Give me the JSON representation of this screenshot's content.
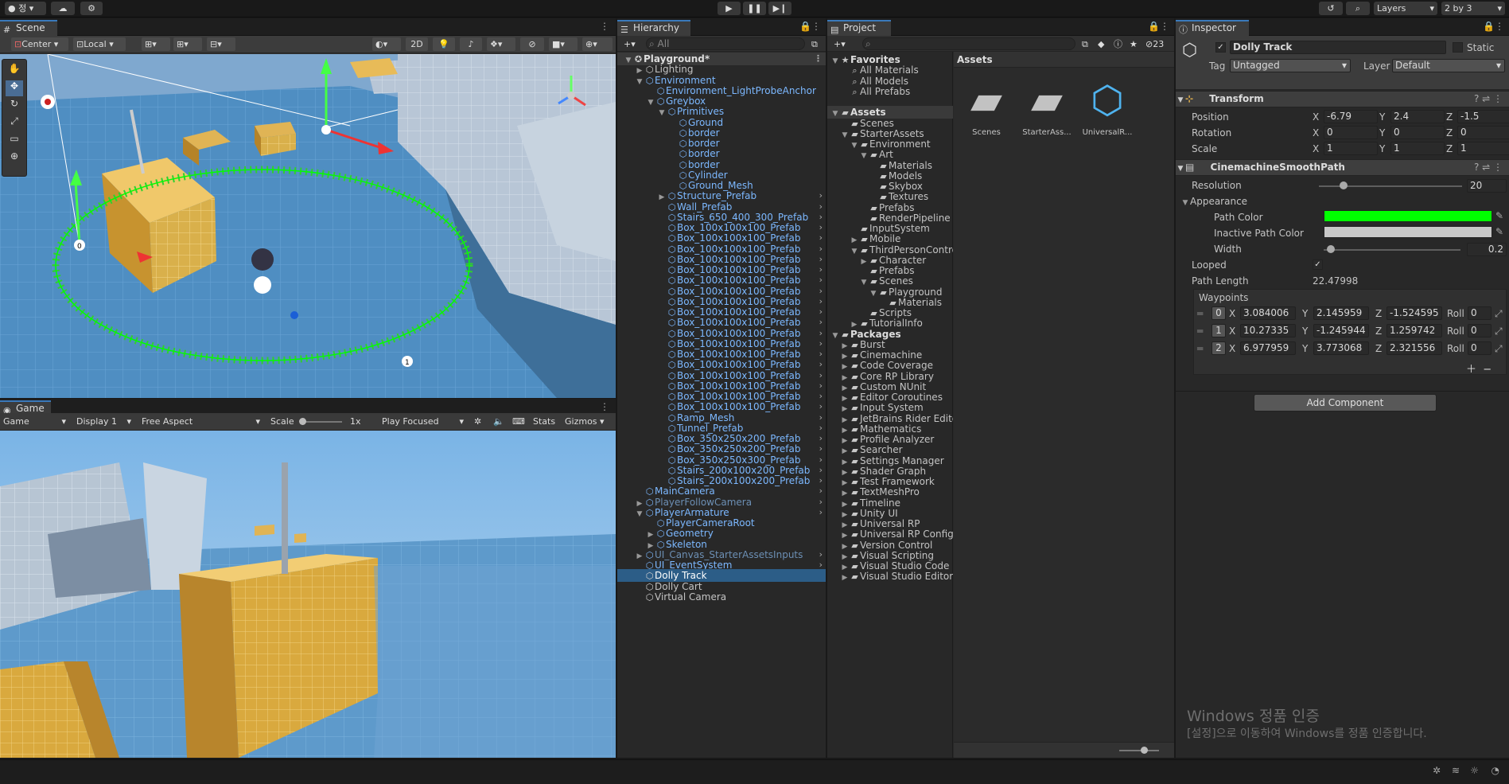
{
  "topbar": {
    "account": "정",
    "play": "▶",
    "pause": "❚❚",
    "step": "▶❙",
    "layers": "Layers",
    "layout": "2 by 3"
  },
  "scene": {
    "tab": "Scene",
    "pivot": "Center",
    "space": "Local",
    "mode2d": "2D",
    "waypoint0": "0",
    "waypoint1": "1"
  },
  "game": {
    "tab": "Game",
    "display_type": "Game",
    "display": "Display 1",
    "aspect": "Free Aspect",
    "scale_label": "Scale",
    "scale_value": "1x",
    "play_mode": "Play Focused",
    "stats": "Stats",
    "gizmos": "Gizmos"
  },
  "hierarchy": {
    "tab": "Hierarchy",
    "search_placeholder": "All",
    "items": [
      {
        "depth": 0,
        "label": "Playground*",
        "style": "root",
        "exp": "open"
      },
      {
        "depth": 1,
        "label": "Lighting",
        "style": "white",
        "exp": "closed"
      },
      {
        "depth": 1,
        "label": "Environment",
        "style": "blue",
        "exp": "open"
      },
      {
        "depth": 2,
        "label": "Environment_LightProbeAnchor",
        "style": "blue",
        "exp": "none"
      },
      {
        "depth": 2,
        "label": "Greybox",
        "style": "blue",
        "exp": "open"
      },
      {
        "depth": 3,
        "label": "Primitives",
        "style": "blue",
        "exp": "open"
      },
      {
        "depth": 4,
        "label": "Ground",
        "style": "blue",
        "exp": "none"
      },
      {
        "depth": 4,
        "label": "border",
        "style": "blue",
        "exp": "none"
      },
      {
        "depth": 4,
        "label": "border",
        "style": "blue",
        "exp": "none"
      },
      {
        "depth": 4,
        "label": "border",
        "style": "blue",
        "exp": "none"
      },
      {
        "depth": 4,
        "label": "border",
        "style": "blue",
        "exp": "none"
      },
      {
        "depth": 4,
        "label": "Cylinder",
        "style": "blue",
        "exp": "none"
      },
      {
        "depth": 4,
        "label": "Ground_Mesh",
        "style": "blue",
        "exp": "none"
      },
      {
        "depth": 3,
        "label": "Structure_Prefab",
        "style": "blue",
        "exp": "closed",
        "more": true
      },
      {
        "depth": 3,
        "label": "Wall_Prefab",
        "style": "blue",
        "exp": "none",
        "more": true
      },
      {
        "depth": 3,
        "label": "Stairs_650_400_300_Prefab",
        "style": "blue",
        "exp": "none",
        "more": true
      },
      {
        "depth": 3,
        "label": "Box_100x100x100_Prefab",
        "style": "blue",
        "exp": "none",
        "more": true
      },
      {
        "depth": 3,
        "label": "Box_100x100x100_Prefab",
        "style": "blue",
        "exp": "none",
        "more": true
      },
      {
        "depth": 3,
        "label": "Box_100x100x100_Prefab",
        "style": "blue",
        "exp": "none",
        "more": true
      },
      {
        "depth": 3,
        "label": "Box_100x100x100_Prefab",
        "style": "blue",
        "exp": "none",
        "more": true
      },
      {
        "depth": 3,
        "label": "Box_100x100x100_Prefab",
        "style": "blue",
        "exp": "none",
        "more": true
      },
      {
        "depth": 3,
        "label": "Box_100x100x100_Prefab",
        "style": "blue",
        "exp": "none",
        "more": true
      },
      {
        "depth": 3,
        "label": "Box_100x100x100_Prefab",
        "style": "blue",
        "exp": "none",
        "more": true
      },
      {
        "depth": 3,
        "label": "Box_100x100x100_Prefab",
        "style": "blue",
        "exp": "none",
        "more": true
      },
      {
        "depth": 3,
        "label": "Box_100x100x100_Prefab",
        "style": "blue",
        "exp": "none",
        "more": true
      },
      {
        "depth": 3,
        "label": "Box_100x100x100_Prefab",
        "style": "blue",
        "exp": "none",
        "more": true
      },
      {
        "depth": 3,
        "label": "Box_100x100x100_Prefab",
        "style": "blue",
        "exp": "none",
        "more": true
      },
      {
        "depth": 3,
        "label": "Box_100x100x100_Prefab",
        "style": "blue",
        "exp": "none",
        "more": true
      },
      {
        "depth": 3,
        "label": "Box_100x100x100_Prefab",
        "style": "blue",
        "exp": "none",
        "more": true
      },
      {
        "depth": 3,
        "label": "Box_100x100x100_Prefab",
        "style": "blue",
        "exp": "none",
        "more": true
      },
      {
        "depth": 3,
        "label": "Box_100x100x100_Prefab",
        "style": "blue",
        "exp": "none",
        "more": true
      },
      {
        "depth": 3,
        "label": "Box_100x100x100_Prefab",
        "style": "blue",
        "exp": "none",
        "more": true
      },
      {
        "depth": 3,
        "label": "Box_100x100x100_Prefab",
        "style": "blue",
        "exp": "none",
        "more": true
      },
      {
        "depth": 3,
        "label": "Box_100x100x100_Prefab",
        "style": "blue",
        "exp": "none",
        "more": true
      },
      {
        "depth": 3,
        "label": "Ramp_Mesh",
        "style": "blue",
        "exp": "none",
        "more": true
      },
      {
        "depth": 3,
        "label": "Tunnel_Prefab",
        "style": "blue",
        "exp": "none",
        "more": true
      },
      {
        "depth": 3,
        "label": "Box_350x250x200_Prefab",
        "style": "blue",
        "exp": "none",
        "more": true
      },
      {
        "depth": 3,
        "label": "Box_350x250x200_Prefab",
        "style": "blue",
        "exp": "none",
        "more": true
      },
      {
        "depth": 3,
        "label": "Box_350x250x300_Prefab",
        "style": "blue",
        "exp": "none",
        "more": true
      },
      {
        "depth": 3,
        "label": "Stairs_200x100x200_Prefab",
        "style": "blue",
        "exp": "none",
        "more": true
      },
      {
        "depth": 3,
        "label": "Stairs_200x100x200_Prefab",
        "style": "blue",
        "exp": "none",
        "more": true
      },
      {
        "depth": 1,
        "label": "MainCamera",
        "style": "blue",
        "exp": "none",
        "more": true
      },
      {
        "depth": 1,
        "label": "PlayerFollowCamera",
        "style": "dim",
        "exp": "closed",
        "more": true
      },
      {
        "depth": 1,
        "label": "PlayerArmature",
        "style": "blue",
        "exp": "open",
        "more": true
      },
      {
        "depth": 2,
        "label": "PlayerCameraRoot",
        "style": "blue",
        "exp": "none"
      },
      {
        "depth": 2,
        "label": "Geometry",
        "style": "blue",
        "exp": "closed"
      },
      {
        "depth": 2,
        "label": "Skeleton",
        "style": "blue",
        "exp": "closed"
      },
      {
        "depth": 1,
        "label": "UI_Canvas_StarterAssetsInputs",
        "style": "dim",
        "exp": "closed",
        "more": true
      },
      {
        "depth": 1,
        "label": "UI_EventSystem",
        "style": "blue",
        "exp": "none",
        "more": true
      },
      {
        "depth": 1,
        "label": "Dolly Track",
        "style": "selected",
        "exp": "none"
      },
      {
        "depth": 1,
        "label": "Dolly Cart",
        "style": "white",
        "exp": "none"
      },
      {
        "depth": 1,
        "label": "Virtual Camera",
        "style": "white",
        "exp": "none"
      }
    ]
  },
  "project": {
    "tab": "Project",
    "hidden_count": "23",
    "breadcrumb": "Assets",
    "tree": [
      {
        "depth": 0,
        "label": "Favorites",
        "type": "star",
        "exp": "open",
        "bold": true
      },
      {
        "depth": 1,
        "label": "All Materials",
        "type": "search",
        "exp": "none"
      },
      {
        "depth": 1,
        "label": "All Models",
        "type": "search",
        "exp": "none"
      },
      {
        "depth": 1,
        "label": "All Prefabs",
        "type": "search",
        "exp": "none"
      },
      {
        "depth": 0,
        "label": "",
        "type": "gap",
        "exp": "none"
      },
      {
        "depth": 0,
        "label": "Assets",
        "type": "folder",
        "exp": "open",
        "bold": true,
        "hl": true
      },
      {
        "depth": 1,
        "label": "Scenes",
        "type": "folder",
        "exp": "none"
      },
      {
        "depth": 1,
        "label": "StarterAssets",
        "type": "folder",
        "exp": "open"
      },
      {
        "depth": 2,
        "label": "Environment",
        "type": "folder",
        "exp": "open"
      },
      {
        "depth": 3,
        "label": "Art",
        "type": "folder",
        "exp": "open"
      },
      {
        "depth": 4,
        "label": "Materials",
        "type": "folder",
        "exp": "none"
      },
      {
        "depth": 4,
        "label": "Models",
        "type": "folder",
        "exp": "none"
      },
      {
        "depth": 4,
        "label": "Skybox",
        "type": "folder",
        "exp": "none"
      },
      {
        "depth": 4,
        "label": "Textures",
        "type": "folder",
        "exp": "none"
      },
      {
        "depth": 3,
        "label": "Prefabs",
        "type": "folder",
        "exp": "none"
      },
      {
        "depth": 3,
        "label": "RenderPipeline",
        "type": "folder",
        "exp": "none"
      },
      {
        "depth": 2,
        "label": "InputSystem",
        "type": "folder",
        "exp": "none"
      },
      {
        "depth": 2,
        "label": "Mobile",
        "type": "folder",
        "exp": "closed"
      },
      {
        "depth": 2,
        "label": "ThirdPersonController",
        "type": "folder",
        "exp": "open"
      },
      {
        "depth": 3,
        "label": "Character",
        "type": "folder",
        "exp": "closed"
      },
      {
        "depth": 3,
        "label": "Prefabs",
        "type": "folder",
        "exp": "none"
      },
      {
        "depth": 3,
        "label": "Scenes",
        "type": "folder",
        "exp": "open"
      },
      {
        "depth": 4,
        "label": "Playground",
        "type": "folder",
        "exp": "open"
      },
      {
        "depth": 5,
        "label": "Materials",
        "type": "folder",
        "exp": "none"
      },
      {
        "depth": 3,
        "label": "Scripts",
        "type": "folder",
        "exp": "none"
      },
      {
        "depth": 2,
        "label": "TutorialInfo",
        "type": "folder",
        "exp": "closed"
      },
      {
        "depth": 0,
        "label": "Packages",
        "type": "folder",
        "exp": "open",
        "bold": true
      },
      {
        "depth": 1,
        "label": "Burst",
        "type": "folder",
        "exp": "closed"
      },
      {
        "depth": 1,
        "label": "Cinemachine",
        "type": "folder",
        "exp": "closed"
      },
      {
        "depth": 1,
        "label": "Code Coverage",
        "type": "folder",
        "exp": "closed"
      },
      {
        "depth": 1,
        "label": "Core RP Library",
        "type": "folder",
        "exp": "closed"
      },
      {
        "depth": 1,
        "label": "Custom NUnit",
        "type": "folder",
        "exp": "closed"
      },
      {
        "depth": 1,
        "label": "Editor Coroutines",
        "type": "folder",
        "exp": "closed"
      },
      {
        "depth": 1,
        "label": "Input System",
        "type": "folder",
        "exp": "closed"
      },
      {
        "depth": 1,
        "label": "JetBrains Rider Editor",
        "type": "folder",
        "exp": "closed"
      },
      {
        "depth": 1,
        "label": "Mathematics",
        "type": "folder",
        "exp": "closed"
      },
      {
        "depth": 1,
        "label": "Profile Analyzer",
        "type": "folder",
        "exp": "closed"
      },
      {
        "depth": 1,
        "label": "Searcher",
        "type": "folder",
        "exp": "closed"
      },
      {
        "depth": 1,
        "label": "Settings Manager",
        "type": "folder",
        "exp": "closed"
      },
      {
        "depth": 1,
        "label": "Shader Graph",
        "type": "folder",
        "exp": "closed"
      },
      {
        "depth": 1,
        "label": "Test Framework",
        "type": "folder",
        "exp": "closed"
      },
      {
        "depth": 1,
        "label": "TextMeshPro",
        "type": "folder",
        "exp": "closed"
      },
      {
        "depth": 1,
        "label": "Timeline",
        "type": "folder",
        "exp": "closed"
      },
      {
        "depth": 1,
        "label": "Unity UI",
        "type": "folder",
        "exp": "closed"
      },
      {
        "depth": 1,
        "label": "Universal RP",
        "type": "folder",
        "exp": "closed"
      },
      {
        "depth": 1,
        "label": "Universal RP Config",
        "type": "folder",
        "exp": "closed"
      },
      {
        "depth": 1,
        "label": "Version Control",
        "type": "folder",
        "exp": "closed"
      },
      {
        "depth": 1,
        "label": "Visual Scripting",
        "type": "folder",
        "exp": "closed"
      },
      {
        "depth": 1,
        "label": "Visual Studio Code",
        "type": "folder",
        "exp": "closed"
      },
      {
        "depth": 1,
        "label": "Visual Studio Editor",
        "type": "folder",
        "exp": "closed"
      }
    ],
    "assets": [
      {
        "label": "Scenes",
        "kind": "folder"
      },
      {
        "label": "StarterAss...",
        "kind": "folder"
      },
      {
        "label": "UniversalR...",
        "kind": "asset"
      }
    ]
  },
  "inspector": {
    "tab": "Inspector",
    "object_name": "Dolly Track",
    "static_label": "Static",
    "tag_label": "Tag",
    "tag_value": "Untagged",
    "layer_label": "Layer",
    "layer_value": "Default",
    "transform": {
      "title": "Transform",
      "position_label": "Position",
      "rotation_label": "Rotation",
      "scale_label": "Scale",
      "position": {
        "x": "-6.79",
        "y": "2.4",
        "z": "-1.5"
      },
      "rotation": {
        "x": "0",
        "y": "0",
        "z": "0"
      },
      "scale": {
        "x": "1",
        "y": "1",
        "z": "1"
      }
    },
    "smooth_path": {
      "title": "CinemachineSmoothPath",
      "resolution_label": "Resolution",
      "resolution_value": "20",
      "appearance_label": "Appearance",
      "path_color_label": "Path Color",
      "path_color": "#00ff00",
      "inactive_color_label": "Inactive Path Color",
      "inactive_color": "#c8c8c8",
      "width_label": "Width",
      "width_value": "0.2",
      "looped_label": "Looped",
      "path_length_label": "Path Length",
      "path_length_value": "22.47998",
      "waypoints_label": "Waypoints",
      "roll_label": "Roll",
      "waypoints": [
        {
          "index": "0",
          "x": "3.084006",
          "y": "2.145959",
          "z": "-1.524595",
          "roll": "0"
        },
        {
          "index": "1",
          "x": "10.27335",
          "y": "-1.245944",
          "z": "1.259742",
          "roll": "0"
        },
        {
          "index": "2",
          "x": "6.977959",
          "y": "3.773068",
          "z": "2.321556",
          "roll": "0"
        }
      ]
    },
    "add_component": "Add Component",
    "watermark_title": "Windows 정품 인증",
    "watermark_sub": "[설정]으로 이동하여 Windows를 정품 인증합니다."
  }
}
